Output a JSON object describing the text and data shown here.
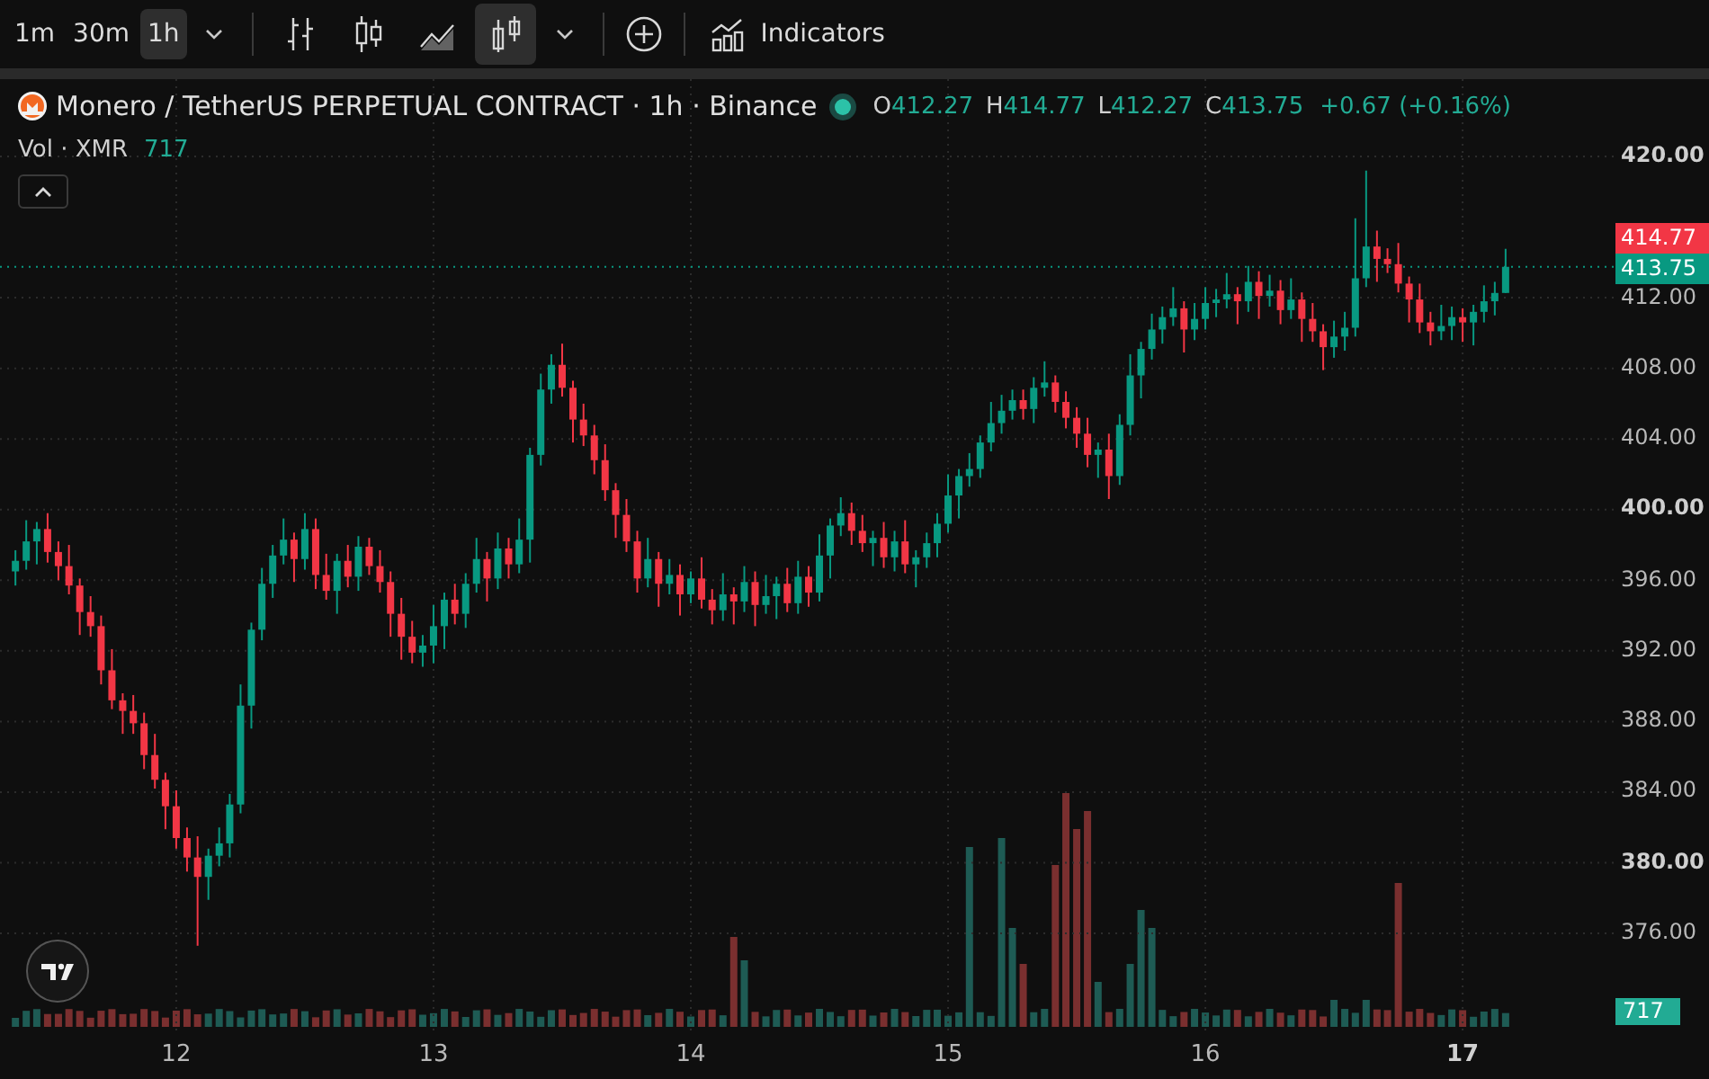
{
  "toolbar": {
    "intervals": [
      {
        "label": "1m",
        "selected": false
      },
      {
        "label": "30m",
        "selected": false
      },
      {
        "label": "1h",
        "selected": true
      }
    ],
    "chart_types": [
      {
        "kind": "bars",
        "selected": false
      },
      {
        "kind": "candles",
        "selected": false
      },
      {
        "kind": "area",
        "selected": false
      },
      {
        "kind": "hollow",
        "selected": true
      }
    ],
    "indicators": "Indicators"
  },
  "legend": {
    "title": "Monero / TetherUS PERPETUAL CONTRACT · 1h · Binance",
    "ohlc": [
      {
        "key": "O",
        "value": "412.27"
      },
      {
        "key": "H",
        "value": "414.77"
      },
      {
        "key": "L",
        "value": "412.27"
      },
      {
        "key": "C",
        "value": "413.75"
      }
    ],
    "change": "+0.67 (+0.16%)",
    "volume_label": "Vol · XMR",
    "volume_value": "717"
  },
  "chart_data": {
    "type": "candlestick",
    "x": [
      11.375,
      11.417,
      11.458,
      11.5,
      11.542,
      11.583,
      11.625,
      11.667,
      11.708,
      11.75,
      11.792,
      11.833,
      11.875,
      11.917,
      11.958,
      12,
      12.042,
      12.083,
      12.125,
      12.167,
      12.208,
      12.25,
      12.292,
      12.333,
      12.375,
      12.417,
      12.458,
      12.5,
      12.542,
      12.583,
      12.625,
      12.667,
      12.708,
      12.75,
      12.792,
      12.833,
      12.875,
      12.917,
      12.958,
      13,
      13.042,
      13.083,
      13.125,
      13.167,
      13.208,
      13.25,
      13.292,
      13.333,
      13.375,
      13.417,
      13.458,
      13.5,
      13.542,
      13.583,
      13.625,
      13.667,
      13.708,
      13.75,
      13.792,
      13.833,
      13.875,
      13.917,
      13.958,
      14,
      14.042,
      14.083,
      14.125,
      14.167,
      14.208,
      14.25,
      14.292,
      14.333,
      14.375,
      14.417,
      14.458,
      14.5,
      14.542,
      14.583,
      14.625,
      14.667,
      14.708,
      14.75,
      14.792,
      14.833,
      14.875,
      14.917,
      14.958,
      15,
      15.042,
      15.083,
      15.125,
      15.167,
      15.208,
      15.25,
      15.292,
      15.333,
      15.375,
      15.417,
      15.458,
      15.5,
      15.542,
      15.583,
      15.625,
      15.667,
      15.708,
      15.75,
      15.792,
      15.833,
      15.875,
      15.917,
      15.958,
      16,
      16.042,
      16.083,
      16.125,
      16.167,
      16.208,
      16.25,
      16.292,
      16.333,
      16.375,
      16.417,
      16.458,
      16.5,
      16.542,
      16.583,
      16.625,
      16.667,
      16.708,
      16.75,
      16.792,
      16.833,
      16.875,
      16.917,
      16.958,
      17,
      17.042,
      17.083,
      17.125,
      17.167
    ],
    "ohlc": [
      [
        396.5,
        397.7,
        395.7,
        397.1
      ],
      [
        397.1,
        399.4,
        396.6,
        398.2
      ],
      [
        398.2,
        399.3,
        396.9,
        398.9
      ],
      [
        398.9,
        399.8,
        397.0,
        397.6
      ],
      [
        397.6,
        398.2,
        396.0,
        396.8
      ],
      [
        396.8,
        398.0,
        395.2,
        395.7
      ],
      [
        395.7,
        396.1,
        392.9,
        394.2
      ],
      [
        394.2,
        395.1,
        392.8,
        393.4
      ],
      [
        393.4,
        394.0,
        390.1,
        390.9
      ],
      [
        390.9,
        392.1,
        388.7,
        389.2
      ],
      [
        389.2,
        389.6,
        387.3,
        388.6
      ],
      [
        388.6,
        389.5,
        387.3,
        387.9
      ],
      [
        387.9,
        388.5,
        385.3,
        386.1
      ],
      [
        386.1,
        387.3,
        384.2,
        384.7
      ],
      [
        384.7,
        385.1,
        381.9,
        383.2
      ],
      [
        383.2,
        384.1,
        380.8,
        381.4
      ],
      [
        381.4,
        382.0,
        379.5,
        380.3
      ],
      [
        380.3,
        381.5,
        375.3,
        379.2
      ],
      [
        379.2,
        380.8,
        377.9,
        380.4
      ],
      [
        380.4,
        382.0,
        379.8,
        381.1
      ],
      [
        381.1,
        383.9,
        380.3,
        383.3
      ],
      [
        383.3,
        390.1,
        382.8,
        388.9
      ],
      [
        388.9,
        393.6,
        387.6,
        393.2
      ],
      [
        393.2,
        396.7,
        392.6,
        395.8
      ],
      [
        395.8,
        398.0,
        395.0,
        397.4
      ],
      [
        397.4,
        399.5,
        396.9,
        398.3
      ],
      [
        398.3,
        398.7,
        395.9,
        397.2
      ],
      [
        397.2,
        399.8,
        396.6,
        398.9
      ],
      [
        398.9,
        399.5,
        395.5,
        396.3
      ],
      [
        396.3,
        397.5,
        394.9,
        395.4
      ],
      [
        395.4,
        397.5,
        394.1,
        397.1
      ],
      [
        397.1,
        398.0,
        395.6,
        396.2
      ],
      [
        396.2,
        398.5,
        395.4,
        397.9
      ],
      [
        397.9,
        398.4,
        396.3,
        396.8
      ],
      [
        396.8,
        397.7,
        395.3,
        395.9
      ],
      [
        395.9,
        396.5,
        392.8,
        394.1
      ],
      [
        394.1,
        395.0,
        391.5,
        392.8
      ],
      [
        392.8,
        393.7,
        391.3,
        391.9
      ],
      [
        391.9,
        392.9,
        391.1,
        392.3
      ],
      [
        392.3,
        394.6,
        391.3,
        393.4
      ],
      [
        393.4,
        395.3,
        392.1,
        394.9
      ],
      [
        394.9,
        395.8,
        393.5,
        394.1
      ],
      [
        394.1,
        396.4,
        393.3,
        395.8
      ],
      [
        395.8,
        398.4,
        395.3,
        397.2
      ],
      [
        397.2,
        397.6,
        394.8,
        396.1
      ],
      [
        396.1,
        398.7,
        395.5,
        397.8
      ],
      [
        397.8,
        398.4,
        396.1,
        396.9
      ],
      [
        396.9,
        399.5,
        396.4,
        398.3
      ],
      [
        398.3,
        403.5,
        397.0,
        403.1
      ],
      [
        403.1,
        407.7,
        402.5,
        406.8
      ],
      [
        406.8,
        408.8,
        406.0,
        408.2
      ],
      [
        408.2,
        409.4,
        406.4,
        406.9
      ],
      [
        406.9,
        407.3,
        403.8,
        405.1
      ],
      [
        405.1,
        406.0,
        403.6,
        404.2
      ],
      [
        404.2,
        404.8,
        402.0,
        402.8
      ],
      [
        402.8,
        403.7,
        400.5,
        401.1
      ],
      [
        401.1,
        401.5,
        398.4,
        399.7
      ],
      [
        399.7,
        400.6,
        397.6,
        398.2
      ],
      [
        398.2,
        398.8,
        395.3,
        396.1
      ],
      [
        396.1,
        398.4,
        395.6,
        397.2
      ],
      [
        397.2,
        397.6,
        394.5,
        395.8
      ],
      [
        395.8,
        397.2,
        395.2,
        396.3
      ],
      [
        396.3,
        396.9,
        394.0,
        395.2
      ],
      [
        395.2,
        396.5,
        394.7,
        396.1
      ],
      [
        396.1,
        397.3,
        394.4,
        394.9
      ],
      [
        394.9,
        395.5,
        393.5,
        394.3
      ],
      [
        394.3,
        396.4,
        393.7,
        395.2
      ],
      [
        395.2,
        395.6,
        393.5,
        394.8
      ],
      [
        394.8,
        396.8,
        394.2,
        395.9
      ],
      [
        395.9,
        396.5,
        393.4,
        394.6
      ],
      [
        394.6,
        396.3,
        394.1,
        395.1
      ],
      [
        395.1,
        396.2,
        393.8,
        395.8
      ],
      [
        395.8,
        396.7,
        394.2,
        394.7
      ],
      [
        394.7,
        397.1,
        394.1,
        396.2
      ],
      [
        396.2,
        396.8,
        394.5,
        395.3
      ],
      [
        395.3,
        398.6,
        394.8,
        397.4
      ],
      [
        397.4,
        399.5,
        396.1,
        399.1
      ],
      [
        399.1,
        400.7,
        398.5,
        399.8
      ],
      [
        399.8,
        400.4,
        398.0,
        398.8
      ],
      [
        398.8,
        399.7,
        397.6,
        398.1
      ],
      [
        398.1,
        398.8,
        396.8,
        398.4
      ],
      [
        398.4,
        399.3,
        396.7,
        397.3
      ],
      [
        397.3,
        398.8,
        396.5,
        398.2
      ],
      [
        398.2,
        399.4,
        396.4,
        396.9
      ],
      [
        396.9,
        397.7,
        395.6,
        397.3
      ],
      [
        397.3,
        398.7,
        396.7,
        398.1
      ],
      [
        398.1,
        399.8,
        397.3,
        399.2
      ],
      [
        399.2,
        402.0,
        398.7,
        400.8
      ],
      [
        400.8,
        402.3,
        399.5,
        401.9
      ],
      [
        401.9,
        403.2,
        401.3,
        402.3
      ],
      [
        402.3,
        404.2,
        401.8,
        403.8
      ],
      [
        403.8,
        406.1,
        403.3,
        404.9
      ],
      [
        404.9,
        406.5,
        404.3,
        405.6
      ],
      [
        405.6,
        406.8,
        405.1,
        406.2
      ],
      [
        406.2,
        406.8,
        405.1,
        405.7
      ],
      [
        405.7,
        407.5,
        404.9,
        406.9
      ],
      [
        406.9,
        408.4,
        406.4,
        407.2
      ],
      [
        407.2,
        407.6,
        405.5,
        406.1
      ],
      [
        406.1,
        406.7,
        404.6,
        405.2
      ],
      [
        405.2,
        405.8,
        403.5,
        404.3
      ],
      [
        404.3,
        405.2,
        402.4,
        403.1
      ],
      [
        403.1,
        403.8,
        401.8,
        403.4
      ],
      [
        403.4,
        404.3,
        400.6,
        401.9
      ],
      [
        401.9,
        405.4,
        401.4,
        404.8
      ],
      [
        404.8,
        408.8,
        404.2,
        407.6
      ],
      [
        407.6,
        409.5,
        406.3,
        409.1
      ],
      [
        409.1,
        411.1,
        408.5,
        410.2
      ],
      [
        410.2,
        411.5,
        409.4,
        410.9
      ],
      [
        410.9,
        412.6,
        410.4,
        411.4
      ],
      [
        411.4,
        411.8,
        408.9,
        410.2
      ],
      [
        410.2,
        411.7,
        409.6,
        410.8
      ],
      [
        410.8,
        412.6,
        410.2,
        411.7
      ],
      [
        411.7,
        412.5,
        410.9,
        411.9
      ],
      [
        411.9,
        413.4,
        411.4,
        412.2
      ],
      [
        412.2,
        412.6,
        410.5,
        411.8
      ],
      [
        411.8,
        413.8,
        411.2,
        412.9
      ],
      [
        412.9,
        413.5,
        410.8,
        412.1
      ],
      [
        412.1,
        413.3,
        411.5,
        412.4
      ],
      [
        412.4,
        413.0,
        410.5,
        411.3
      ],
      [
        411.3,
        413.1,
        410.8,
        411.9
      ],
      [
        411.9,
        412.3,
        409.5,
        410.8
      ],
      [
        410.8,
        411.7,
        409.5,
        410.1
      ],
      [
        410.1,
        410.5,
        407.9,
        409.2
      ],
      [
        409.2,
        410.7,
        408.6,
        409.8
      ],
      [
        409.8,
        411.2,
        409.0,
        410.3
      ],
      [
        410.3,
        416.5,
        409.8,
        413.1
      ],
      [
        413.1,
        419.2,
        412.6,
        414.9
      ],
      [
        414.9,
        415.8,
        412.9,
        414.2
      ],
      [
        414.2,
        414.8,
        413.4,
        413.9
      ],
      [
        413.9,
        415.1,
        412.3,
        412.8
      ],
      [
        412.8,
        413.2,
        410.6,
        411.9
      ],
      [
        411.9,
        412.8,
        410.0,
        410.6
      ],
      [
        410.6,
        411.2,
        409.3,
        410.1
      ],
      [
        410.1,
        411.6,
        409.6,
        410.4
      ],
      [
        410.4,
        411.5,
        409.6,
        410.9
      ],
      [
        410.9,
        411.4,
        409.5,
        410.6
      ],
      [
        410.6,
        411.6,
        409.3,
        411.2
      ],
      [
        411.2,
        412.7,
        410.6,
        411.8
      ],
      [
        411.8,
        412.9,
        411.0,
        412.27
      ],
      [
        412.27,
        414.77,
        412.27,
        413.75
      ]
    ],
    "xlim": [
      11.315,
      17.594
    ],
    "ylim": [
      370.3,
      424.38
    ],
    "grid": true,
    "ref_lines": [
      {
        "axis": "y",
        "value": 413.75
      }
    ],
    "yticks": [
      {
        "value": 420,
        "label": "420.00"
      },
      {
        "value": 412,
        "label": "412.00"
      },
      {
        "value": 408,
        "label": "408.00"
      },
      {
        "value": 404,
        "label": "404.00"
      },
      {
        "value": 400,
        "label": "400.00"
      },
      {
        "value": 396,
        "label": "396.00"
      },
      {
        "value": 392,
        "label": "392.00"
      },
      {
        "value": 388,
        "label": "388.00"
      },
      {
        "value": 384,
        "label": "384.00"
      },
      {
        "value": 380,
        "label": "380.00"
      },
      {
        "value": 376,
        "label": "376.00"
      }
    ],
    "xticks": [
      {
        "value": 12,
        "label": "12"
      },
      {
        "value": 13,
        "label": "13"
      },
      {
        "value": 14,
        "label": "14"
      },
      {
        "value": 15,
        "label": "15"
      },
      {
        "value": 16,
        "label": "16"
      },
      {
        "value": 17,
        "label": "17"
      }
    ]
  },
  "ytick_styles": [
    {
      "major": true
    },
    {
      "major": false
    },
    {
      "major": false
    },
    {
      "major": false
    },
    {
      "major": true
    },
    {
      "major": false
    },
    {
      "major": false
    },
    {
      "major": false
    },
    {
      "major": false
    },
    {
      "major": true
    },
    {
      "major": false
    }
  ],
  "xtick_styles": [
    {
      "major": false
    },
    {
      "major": false
    },
    {
      "major": false
    },
    {
      "major": false
    },
    {
      "major": false
    },
    {
      "major": true
    }
  ],
  "price_badges": [
    {
      "kind": "high",
      "value": "414.77"
    },
    {
      "kind": "last",
      "value": "413.75"
    }
  ],
  "volume_badge": "717"
}
